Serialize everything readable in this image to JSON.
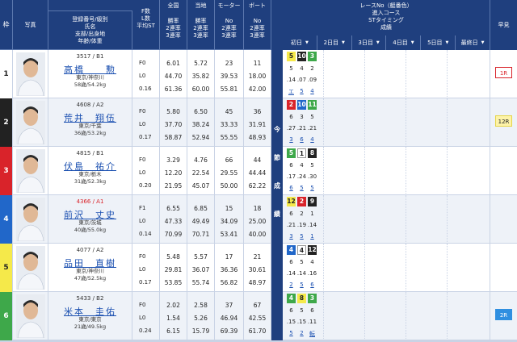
{
  "header": {
    "boat_racer": "ボートレーサー",
    "lane": "枠",
    "photo": "写真",
    "info_lines": [
      "登録番号/級別",
      "氏名",
      "支部/出身地",
      "年齢/体重"
    ],
    "st_lines": [
      "F数",
      "L数",
      "平均ST"
    ],
    "national": "全国",
    "local": "当地",
    "motor": "モーター",
    "boat": "ボート",
    "rate_lines_a": [
      "勝率",
      "2連率",
      "3連率"
    ],
    "rate_lines_b": [
      "No",
      "2連率",
      "3連率"
    ],
    "right_title_lines": [
      "レースNo（艇番色）",
      "進入コース",
      "STタイミング",
      "成績"
    ],
    "days": [
      "初日",
      "2日目",
      "3日目",
      "4日目",
      "5日目",
      "最終日"
    ],
    "early": "早見",
    "mid_label": [
      "今",
      "節",
      "成",
      "績"
    ]
  },
  "racers": [
    {
      "lane": "1",
      "lane_bg": "#ffffff",
      "lane_color": "#222222",
      "reg": "3517 / B1",
      "class_color": "#333333",
      "name": "高橋　　勲",
      "branch": "東京/神奈川",
      "age_weight": "58歳/54.2kg",
      "f": "F0",
      "l": "L0",
      "st": "0.16",
      "nat": [
        "6.01",
        "44.70",
        "61.36"
      ],
      "loc": [
        "5.72",
        "35.82",
        "60.00"
      ],
      "motor": [
        "23",
        "39.53",
        "55.81"
      ],
      "boat": [
        "11",
        "18.00",
        "42.00"
      ],
      "races": [
        {
          "lane": "5",
          "bg": "#f5e94a",
          "fg": "#222",
          "course": "5",
          "st": ".14",
          "res": "エ"
        },
        {
          "lane": "10",
          "bg": "#222222",
          "fg": "#fff",
          "course": "4",
          "st": ".07",
          "res": "5"
        },
        {
          "lane": "3",
          "bg": "#3ea84a",
          "fg": "#fff",
          "course": "2",
          "st": ".09",
          "res": "4"
        }
      ],
      "early": "1R",
      "early_bg": "#ffffff",
      "early_color": "#d9232a",
      "early_border": "#d9232a"
    },
    {
      "lane": "2",
      "lane_bg": "#222222",
      "lane_color": "#ffffff",
      "reg": "4608 / A2",
      "class_color": "#333333",
      "name": "荒井　翔伍",
      "branch": "東京/千葉",
      "age_weight": "36歳/53.2kg",
      "f": "F0",
      "l": "L0",
      "st": "0.17",
      "nat": [
        "5.80",
        "37.70",
        "58.87"
      ],
      "loc": [
        "6.50",
        "38.24",
        "52.94"
      ],
      "motor": [
        "45",
        "33.33",
        "55.55"
      ],
      "boat": [
        "36",
        "31.91",
        "48.93"
      ],
      "races": [
        {
          "lane": "2",
          "bg": "#d9232a",
          "fg": "#fff",
          "course": "6",
          "st": ".27",
          "res": "3"
        },
        {
          "lane": "10",
          "bg": "#2167c9",
          "fg": "#fff",
          "course": "3",
          "st": ".21",
          "res": "6"
        },
        {
          "lane": "11",
          "bg": "#3ea84a",
          "fg": "#fff",
          "course": "5",
          "st": ".21",
          "res": "4"
        }
      ],
      "early": "12R",
      "early_bg": "#fdf3a8",
      "early_color": "#222222",
      "early_border": "#e6d54a"
    },
    {
      "lane": "3",
      "lane_bg": "#d9232a",
      "lane_color": "#ffffff",
      "reg": "4815 / B1",
      "class_color": "#333333",
      "name": "伏島　祐介",
      "branch": "東京/栃木",
      "age_weight": "31歳/52.3kg",
      "f": "F0",
      "l": "L0",
      "st": "0.20",
      "nat": [
        "3.29",
        "12.20",
        "21.95"
      ],
      "loc": [
        "4.76",
        "22.54",
        "45.07"
      ],
      "motor": [
        "66",
        "29.55",
        "50.00"
      ],
      "boat": [
        "44",
        "44.44",
        "62.22"
      ],
      "races": [
        {
          "lane": "5",
          "bg": "#3ea84a",
          "fg": "#fff",
          "course": "6",
          "st": ".17",
          "res": "6"
        },
        {
          "lane": "1",
          "bg": "#ffffff",
          "fg": "#222",
          "course": "4",
          "st": ".24",
          "res": "5"
        },
        {
          "lane": "8",
          "bg": "#222222",
          "fg": "#fff",
          "course": "5",
          "st": ".30",
          "res": "5"
        }
      ],
      "early": "",
      "early_bg": "",
      "early_color": "",
      "early_border": ""
    },
    {
      "lane": "4",
      "lane_bg": "#2167c9",
      "lane_color": "#ffffff",
      "reg": "4366 / A1",
      "class_color": "#d9232a",
      "name": "前沢　丈史",
      "branch": "東京/茨城",
      "age_weight": "40歳/55.0kg",
      "f": "F1",
      "l": "L0",
      "st": "0.14",
      "nat": [
        "6.55",
        "47.33",
        "70.99"
      ],
      "loc": [
        "6.85",
        "49.49",
        "70.71"
      ],
      "motor": [
        "15",
        "34.09",
        "53.41"
      ],
      "boat": [
        "18",
        "25.00",
        "40.00"
      ],
      "races": [
        {
          "lane": "12",
          "bg": "#f5e94a",
          "fg": "#222",
          "course": "6",
          "st": ".21",
          "res": "3"
        },
        {
          "lane": "2",
          "bg": "#d9232a",
          "fg": "#fff",
          "course": "2",
          "st": ".19",
          "res": "5"
        },
        {
          "lane": "9",
          "bg": "#222222",
          "fg": "#fff",
          "course": "1",
          "st": ".14",
          "res": "1"
        }
      ],
      "early": "",
      "early_bg": "",
      "early_color": "",
      "early_border": ""
    },
    {
      "lane": "5",
      "lane_bg": "#f5e94a",
      "lane_color": "#222222",
      "reg": "4077 / A2",
      "class_color": "#333333",
      "name": "品田　直樹",
      "branch": "東京/神奈川",
      "age_weight": "47歳/52.5kg",
      "f": "F0",
      "l": "L0",
      "st": "0.17",
      "nat": [
        "5.48",
        "29.81",
        "53.85"
      ],
      "loc": [
        "5.57",
        "36.07",
        "55.74"
      ],
      "motor": [
        "17",
        "36.36",
        "56.82"
      ],
      "boat": [
        "21",
        "30.61",
        "48.97"
      ],
      "races": [
        {
          "lane": "4",
          "bg": "#2167c9",
          "fg": "#fff",
          "course": "6",
          "st": ".14",
          "res": "2"
        },
        {
          "lane": "4",
          "bg": "#ffffff",
          "fg": "#222",
          "course": "5",
          "st": ".14",
          "res": "5"
        },
        {
          "lane": "12",
          "bg": "#222222",
          "fg": "#fff",
          "course": "4",
          "st": ".16",
          "res": "6"
        }
      ],
      "early": "",
      "early_bg": "",
      "early_color": "",
      "early_border": ""
    },
    {
      "lane": "6",
      "lane_bg": "#3ea84a",
      "lane_color": "#ffffff",
      "reg": "5433 / B2",
      "class_color": "#333333",
      "name": "米本　圭佑",
      "branch": "東京/東京",
      "age_weight": "21歳/49.5kg",
      "f": "F0",
      "l": "L0",
      "st": "0.24",
      "nat": [
        "2.02",
        "1.54",
        "6.15"
      ],
      "loc": [
        "2.58",
        "5.26",
        "15.79"
      ],
      "motor": [
        "37",
        "46.94",
        "69.39"
      ],
      "boat": [
        "67",
        "42.55",
        "61.70"
      ],
      "races": [
        {
          "lane": "4",
          "bg": "#3ea84a",
          "fg": "#fff",
          "course": "6",
          "st": ".15",
          "res": "5"
        },
        {
          "lane": "8",
          "bg": "#f5e94a",
          "fg": "#222",
          "course": "5",
          "st": ".15",
          "res": "2"
        },
        {
          "lane": "3",
          "bg": "#3ea84a",
          "fg": "#fff",
          "course": "6",
          "st": ".11",
          "res": "転"
        }
      ],
      "early": "2R",
      "early_bg": "#2f8fe0",
      "early_color": "#ffffff",
      "early_border": "#2f8fe0"
    }
  ]
}
